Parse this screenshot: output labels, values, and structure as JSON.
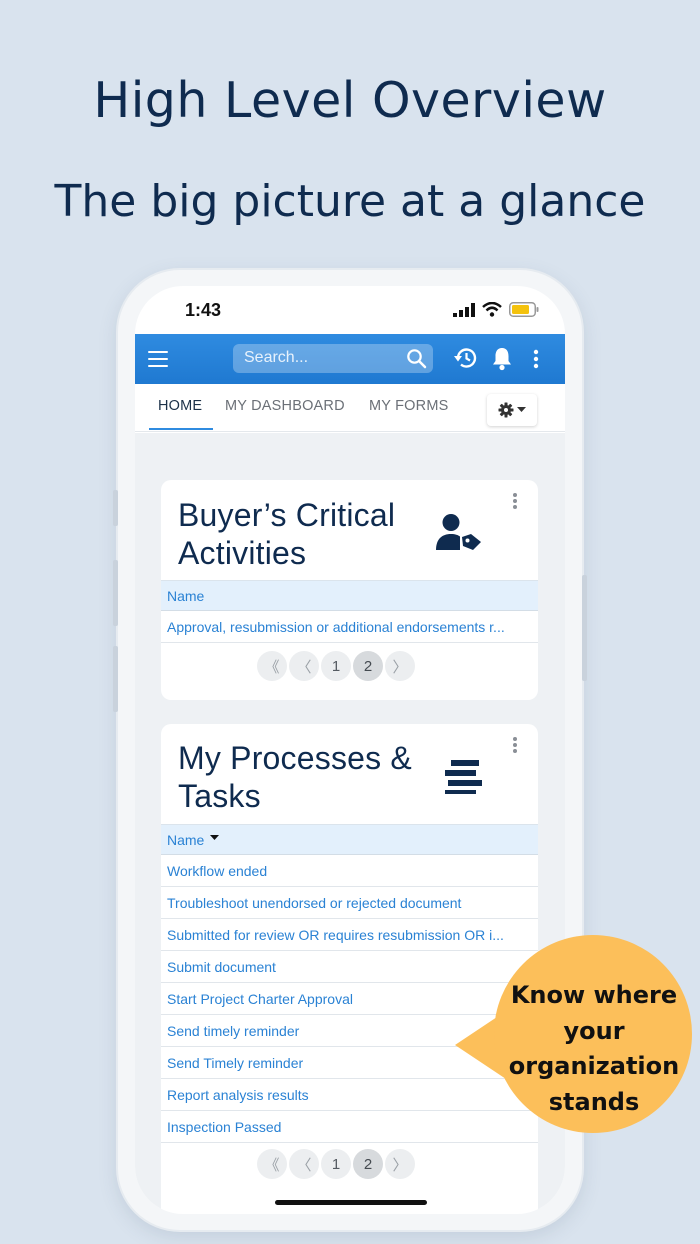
{
  "headline": "High Level Overview",
  "subheadline": "The big picture at a glance",
  "status_bar": {
    "time": "1:43"
  },
  "app_bar": {
    "search_placeholder": "Search..."
  },
  "tabs": [
    "HOME",
    "MY DASHBOARD",
    "MY FORMS"
  ],
  "buyer_card": {
    "title_line1": "Buyer’s Critical",
    "title_line2": "Activities",
    "icon": "user-tag-icon",
    "column": "Name",
    "rows": [
      "Approval, resubmission or additional endorsements r..."
    ],
    "pager": {
      "first": "《",
      "prev": "〈",
      "pages": [
        "1",
        "2"
      ],
      "next": "〉",
      "current": "2"
    }
  },
  "processes_card": {
    "title_line1": "My Processes &",
    "title_line2": "Tasks",
    "icon": "list-stack-icon",
    "column": "Name",
    "rows": [
      "Workflow ended",
      "Troubleshoot unendorsed or rejected document",
      "Submitted for review OR requires resubmission OR i...",
      "Submit document",
      "Start Project Charter Approval",
      "Send timely reminder",
      "Send Timely reminder",
      "Report analysis results",
      "Inspection Passed"
    ],
    "pager": {
      "first": "《",
      "prev": "〈",
      "pages": [
        "1",
        "2"
      ],
      "next": "〉",
      "current": "2"
    }
  },
  "callout": {
    "lines": [
      "Know where",
      "your",
      "organization",
      "stands"
    ]
  },
  "colors": {
    "accent": "#2f8be0",
    "navy": "#0f2b4f",
    "callout": "#fcbf5a",
    "link": "#2a82d4"
  }
}
